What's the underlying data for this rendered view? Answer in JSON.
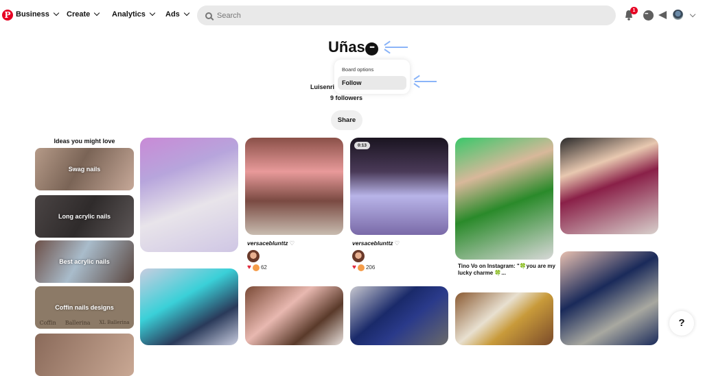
{
  "nav": {
    "logo": "P",
    "items": [
      {
        "label": "Business"
      },
      {
        "label": "Create"
      },
      {
        "label": "Analytics"
      },
      {
        "label": "Ads"
      }
    ],
    "search_placeholder": "Search",
    "notification_count": "1"
  },
  "board": {
    "title": "Uñas",
    "more_icon": "•••",
    "owner": "Luisenri",
    "followers": "9 followers",
    "share_label": "Share"
  },
  "popup": {
    "heading": "Board options",
    "follow_label": "Follow"
  },
  "ideas": {
    "title": "Ideas you might love",
    "items": [
      {
        "label": "Swag nails"
      },
      {
        "label": "Long acrylic nails"
      },
      {
        "label": "Best acrylic nails"
      },
      {
        "label": "Coffin nails designs",
        "sublabels": [
          "Coffin",
          "Ballerina",
          "XL Ballerina"
        ]
      }
    ]
  },
  "pins": {
    "pin2": {
      "user": "versaceblunttz",
      "reaction_count": "62",
      "avatar_text": "·"
    },
    "pin3": {
      "user": "versaceblunttz",
      "reaction_count": "206",
      "video_duration": "0:13",
      "avatar_text": "·"
    },
    "pin4": {
      "caption": "Tino Vo on Instagram: \"🍀you are my lucky charme 🍀..."
    }
  },
  "help": {
    "label": "?"
  },
  "colors": {
    "brand": "#e60023",
    "annotation_arrow": "#8ab4f8"
  }
}
